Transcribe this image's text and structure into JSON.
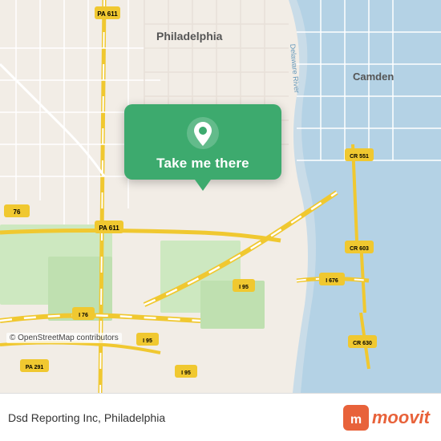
{
  "map": {
    "attribution": "© OpenStreetMap contributors",
    "background": "#e8e0d8"
  },
  "callout": {
    "label": "Take me there",
    "pin_icon": "location-pin"
  },
  "bottom_bar": {
    "location_name": "Dsd Reporting Inc, Philadelphia",
    "brand": "moovit"
  }
}
